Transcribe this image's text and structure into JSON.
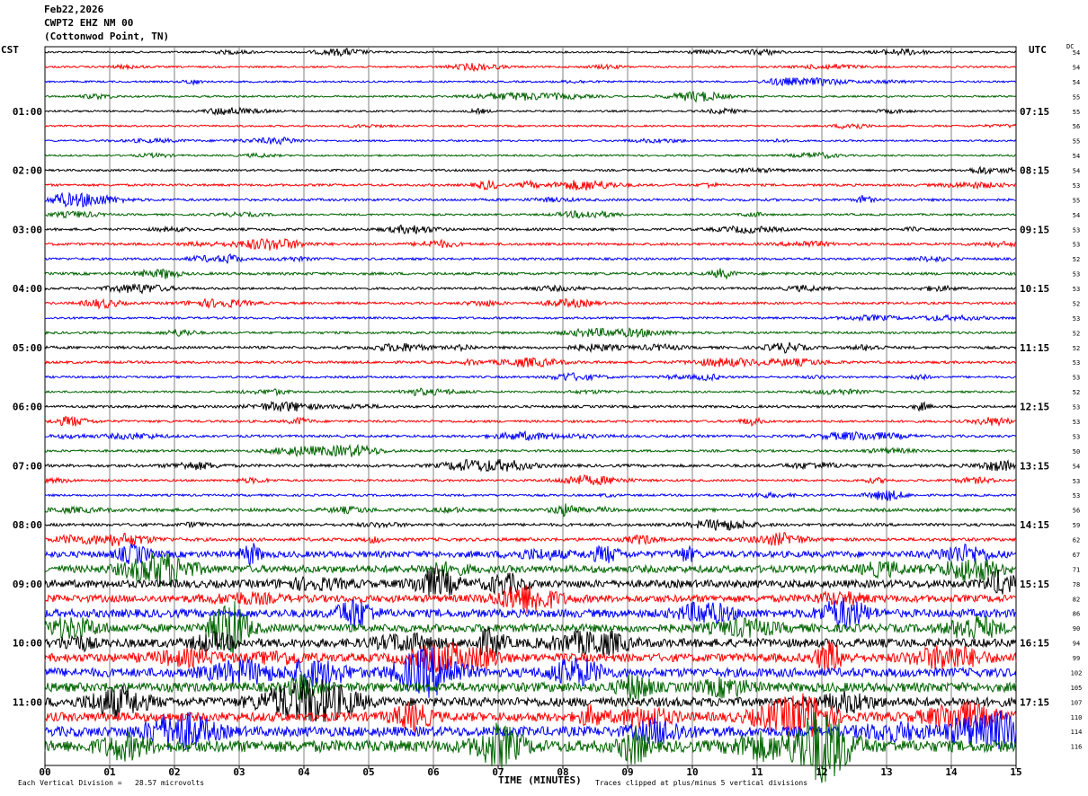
{
  "header": {
    "date": "Feb22,2026",
    "station": "CWPT2 EHZ NM 00",
    "location": "(Cottonwod Point, TN)"
  },
  "left_zone": "CST",
  "right_zone": "UTC",
  "dc_header": "DC",
  "footer": {
    "scale_note": "Each Vertical Division =   28.57 microvolts",
    "x_title": "TIME (MINUTES)",
    "clip_note": "Traces clipped at plus/minus 5 vertical divisions"
  },
  "chart_data": {
    "type": "line",
    "title": "",
    "xlabel": "TIME (MINUTES)",
    "xlim": [
      0,
      15
    ],
    "x_ticks": [
      "00",
      "01",
      "02",
      "03",
      "04",
      "05",
      "06",
      "07",
      "08",
      "09",
      "10",
      "11",
      "12",
      "13",
      "14",
      "15"
    ],
    "grid": true,
    "row_interval_minutes": 15,
    "trace_colors": [
      "#000000",
      "#ff0000",
      "#0000ff",
      "#006400"
    ],
    "left_hour_labels": [
      "01:00",
      "02:00",
      "03:00",
      "04:00",
      "05:00",
      "06:00",
      "07:00",
      "08:00",
      "09:00",
      "10:00",
      "11:00"
    ],
    "right_hour_labels": [
      "07:15",
      "08:15",
      "09:15",
      "10:15",
      "11:15",
      "12:15",
      "13:15",
      "14:15",
      "15:15",
      "16:15",
      "17:15"
    ],
    "hour_label_row_start": 4,
    "dc_offsets": [
      "54",
      "54",
      "54",
      "55",
      "55",
      "56",
      "55",
      "54",
      "54",
      "53",
      "55",
      "54",
      "53",
      "53",
      "52",
      "53",
      "53",
      "52",
      "53",
      "52",
      "52",
      "53",
      "53",
      "52",
      "53",
      "53",
      "53",
      "50",
      "54",
      "53",
      "53",
      "56",
      "59",
      "62",
      "67",
      "71",
      "78",
      "82",
      "86",
      "90",
      "94",
      "99",
      "102",
      "105",
      "107",
      "110",
      "114",
      "116"
    ],
    "row_amplitude": [
      1,
      1,
      1,
      1,
      1,
      1,
      1,
      1,
      1.2,
      1.3,
      1.4,
      1.1,
      1.4,
      1.4,
      1.3,
      1.5,
      1.3,
      1.3,
      1.2,
      1.3,
      1.5,
      1.4,
      1.2,
      1.1,
      1.4,
      1.3,
      1.4,
      1.3,
      1.6,
      1.2,
      1.2,
      1.8,
      1.6,
      1.8,
      3.5,
      4,
      4.2,
      4,
      4.5,
      4.5,
      4.8,
      4.6,
      5,
      5.2,
      5,
      5,
      5.5,
      6.5
    ]
  }
}
